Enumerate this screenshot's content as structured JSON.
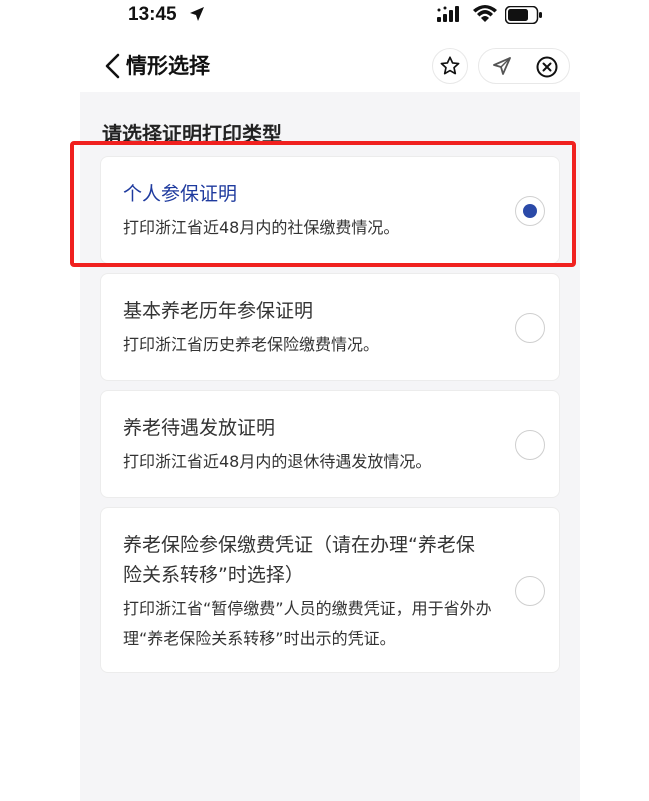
{
  "status_bar": {
    "time": "13:45"
  },
  "header": {
    "title": "情形选择"
  },
  "section_title": "请选择证明打印类型",
  "options": [
    {
      "title": "个人参保证明",
      "desc": "打印浙江省近48月内的社保缴费情况。",
      "selected": true
    },
    {
      "title": "基本养老历年参保证明",
      "desc": "打印浙江省历史养老保险缴费情况。",
      "selected": false
    },
    {
      "title": "养老待遇发放证明",
      "desc": "打印浙江省近48月内的退休待遇发放情况。",
      "selected": false
    },
    {
      "title": "养老保险参保缴费凭证（请在办理“养老保险关系转移”时选择）",
      "desc": "打印浙江省“暂停缴费”人员的缴费凭证，用于省外办理“养老保险关系转移”时出示的凭证。",
      "selected": false
    }
  ],
  "colors": {
    "accent": "#2b4aa8",
    "highlight": "#f0211f",
    "background": "#f5f5f7"
  }
}
